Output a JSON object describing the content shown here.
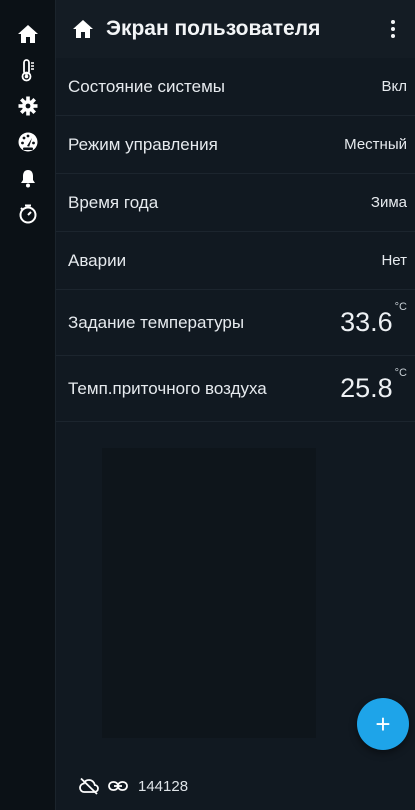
{
  "rail": {
    "items": [
      {
        "name": "home",
        "active": true
      },
      {
        "name": "thermometer"
      },
      {
        "name": "settings"
      },
      {
        "name": "gauge"
      },
      {
        "name": "bell"
      },
      {
        "name": "timer"
      }
    ]
  },
  "header": {
    "title": "Экран пользователя"
  },
  "rows": [
    {
      "label": "Состояние системы",
      "value": "Вкл"
    },
    {
      "label": "Режим управления",
      "value": "Местный"
    },
    {
      "label": "Время года",
      "value": "Зима"
    },
    {
      "label": "Аварии",
      "value": "Нет"
    },
    {
      "label": "Задание температуры",
      "value": "33.6",
      "unit": "°C"
    },
    {
      "label": "Темп.приточного воздуха",
      "value": "25.8",
      "unit": "°C"
    }
  ],
  "fab": {
    "label": "+"
  },
  "footer": {
    "device_id": "144128"
  },
  "colors": {
    "accent": "#1ea4e9",
    "background": "#111921",
    "rail": "#0b1116"
  }
}
